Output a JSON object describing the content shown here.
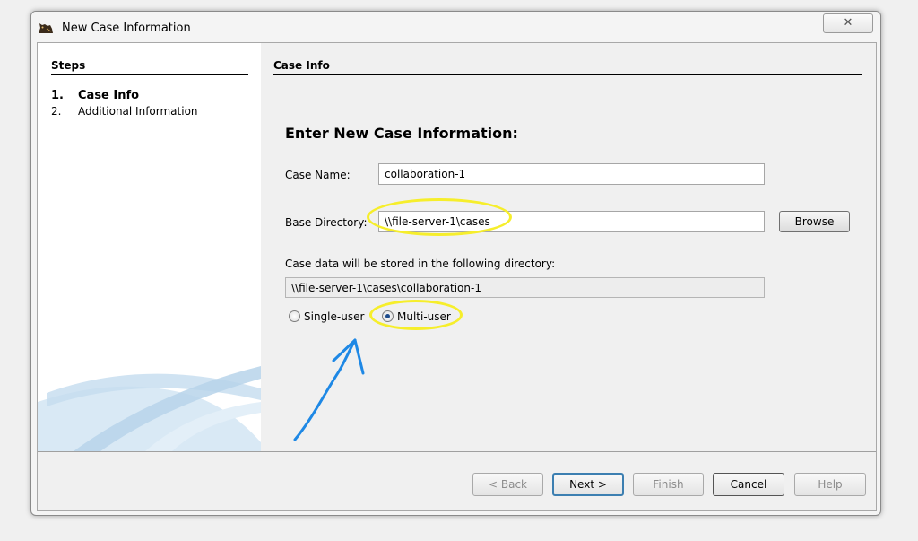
{
  "window": {
    "title": "New Case Information",
    "close_glyph": "✕"
  },
  "steps": {
    "header": "Steps",
    "items": [
      {
        "number": "1.",
        "label": "Case Info",
        "active": true
      },
      {
        "number": "2.",
        "label": "Additional Information",
        "active": false
      }
    ]
  },
  "panel": {
    "header": "Case Info",
    "heading": "Enter New Case Information:",
    "case_name": {
      "label": "Case Name:",
      "value": "collaboration-1"
    },
    "base_directory": {
      "label": "Base Directory:",
      "value": "\\\\file-server-1\\cases"
    },
    "browse_label": "Browse",
    "storage_note": "Case data will be stored in the following directory:",
    "storage_path": "\\\\file-server-1\\cases\\collaboration-1",
    "case_type": {
      "options": [
        {
          "label": "Single-user",
          "selected": false
        },
        {
          "label": "Multi-user",
          "selected": true
        }
      ]
    }
  },
  "footer": {
    "back_label": "< Back",
    "next_label": "Next >",
    "finish_label": "Finish",
    "cancel_label": "Cancel",
    "help_label": "Help"
  },
  "annotations": {
    "highlight_color": "#f6ee2b",
    "arrow_color": "#1e88e5"
  },
  "icons": {
    "app": "autopsy-dog-icon",
    "close": "close-icon"
  }
}
